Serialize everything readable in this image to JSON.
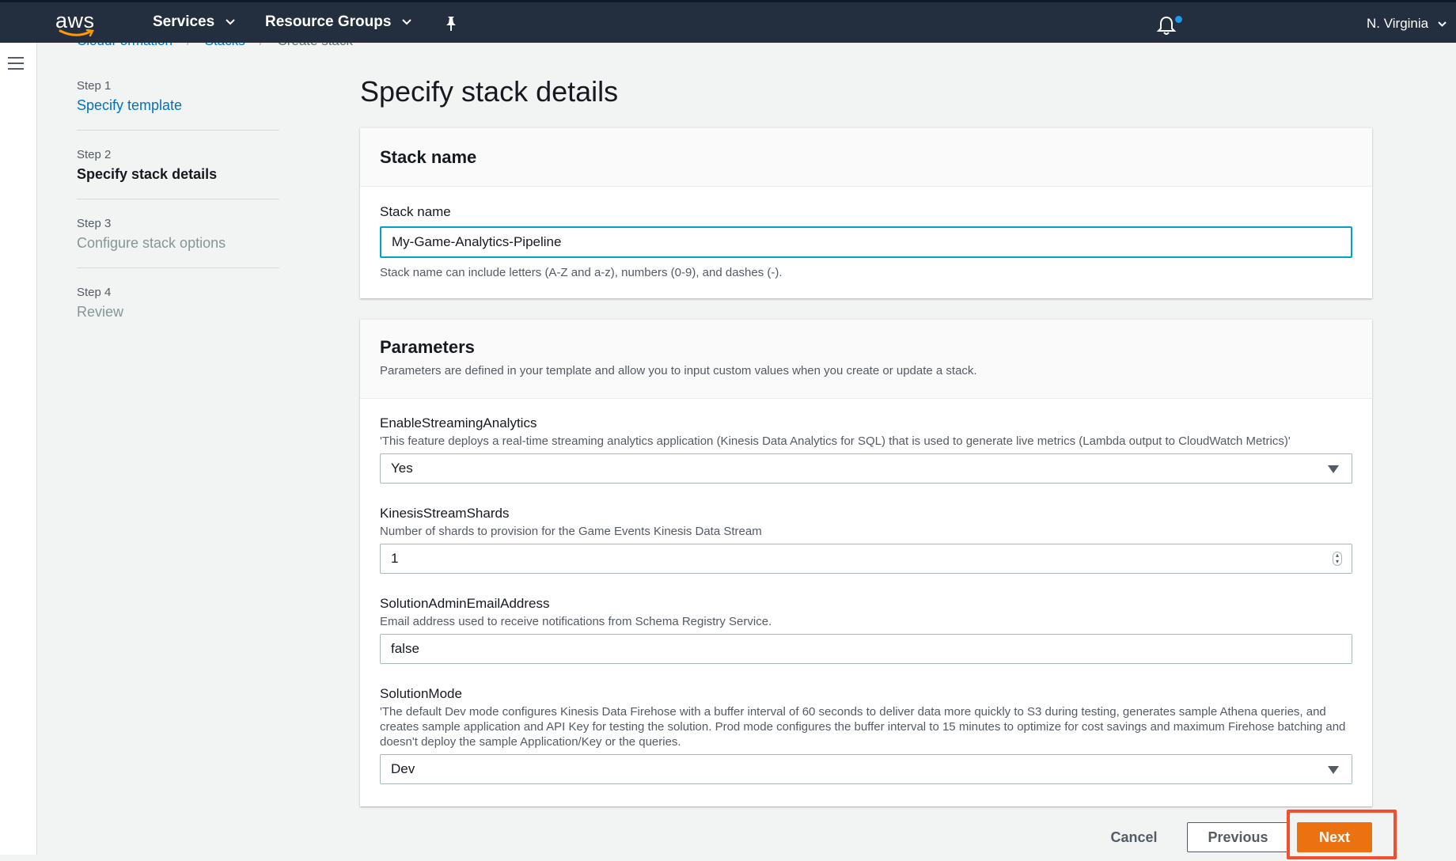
{
  "nav": {
    "logo_text": "aws",
    "services_label": "Services",
    "resource_groups_label": "Resource Groups",
    "region_label": "N. Virginia"
  },
  "breadcrumb": [
    "CloudFormation",
    "Stacks",
    "Create stack"
  ],
  "steps": [
    {
      "num": "Step 1",
      "label": "Specify template",
      "state": "link"
    },
    {
      "num": "Step 2",
      "label": "Specify stack details",
      "state": "current"
    },
    {
      "num": "Step 3",
      "label": "Configure stack options",
      "state": "disabled"
    },
    {
      "num": "Step 4",
      "label": "Review",
      "state": "disabled"
    }
  ],
  "page_title": "Specify stack details",
  "stack_name_panel": {
    "title": "Stack name",
    "field_label": "Stack name",
    "value": "My-Game-Analytics-Pipeline",
    "hint": "Stack name can include letters (A-Z and a-z), numbers (0-9), and dashes (-)."
  },
  "parameters_panel": {
    "title": "Parameters",
    "subtitle": "Parameters are defined in your template and allow you to input custom values when you create or update a stack.",
    "params": [
      {
        "name": "EnableStreamingAnalytics",
        "desc": "'This feature deploys a real-time streaming analytics application (Kinesis Data Analytics for SQL) that is used to generate live metrics (Lambda output to CloudWatch Metrics)'",
        "value": "Yes",
        "control": "select"
      },
      {
        "name": "KinesisStreamShards",
        "desc": "Number of shards to provision for the Game Events Kinesis Data Stream",
        "value": "1",
        "control": "number"
      },
      {
        "name": "SolutionAdminEmailAddress",
        "desc": "Email address used to receive notifications from Schema Registry Service.",
        "value": "false",
        "control": "text"
      },
      {
        "name": "SolutionMode",
        "desc": "'The default Dev mode configures Kinesis Data Firehose with a buffer interval of 60 seconds to deliver data more quickly to S3 during testing, generates sample Athena queries, and creates sample application and API Key for testing the solution. Prod mode configures the buffer interval to 15 minutes to optimize for cost savings and maximum Firehose batching and doesn't deploy the sample Application/Key or the queries.",
        "value": "Dev",
        "control": "select"
      }
    ]
  },
  "buttons": {
    "cancel": "Cancel",
    "previous": "Previous",
    "next": "Next"
  },
  "colors": {
    "nav_bg": "#232f3e",
    "link": "#0073bb",
    "primary": "#ec7211",
    "focus": "#00a1c9",
    "highlight": "#f0502f"
  }
}
